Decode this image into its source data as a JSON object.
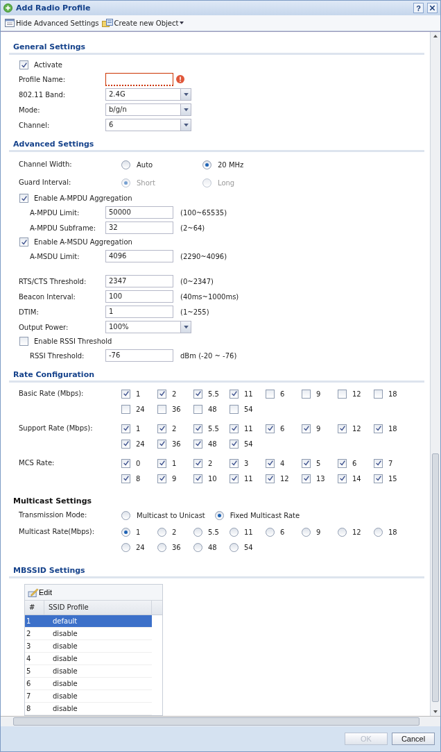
{
  "window": {
    "title": "Add Radio Profile",
    "help": "?"
  },
  "toolbar": [
    {
      "label": "Hide Advanced Settings",
      "kind": "settings",
      "dropdown": false
    },
    {
      "label": "Create new Object",
      "kind": "object",
      "dropdown": true
    }
  ],
  "sections": [
    {
      "kind": "banner",
      "title": "General Settings",
      "rows": [
        {
          "kind": "checkbox",
          "label": "Activate",
          "checked": true
        },
        {
          "kind": "text",
          "label": "Profile Name:",
          "invalid": true
        },
        {
          "kind": "select",
          "label": "802.11 Band:",
          "value": "2.4G"
        },
        {
          "kind": "select",
          "label": "Mode:",
          "value": "b/g/n"
        },
        {
          "kind": "select",
          "label": "Channel:",
          "value": "6"
        }
      ]
    },
    {
      "kind": "banner",
      "title": "Advanced Settings",
      "rows": [
        {
          "kind": "radio",
          "label": "Channel Width:",
          "disabled": false,
          "options": [
            {
              "label": "Auto",
              "selected": false
            },
            {
              "label": "20 MHz",
              "selected": true
            }
          ]
        },
        {
          "kind": "radio",
          "label": "Guard Interval:",
          "disabled": true,
          "options": [
            {
              "label": "Short",
              "selected": true
            },
            {
              "label": "Long",
              "selected": false
            }
          ]
        },
        {
          "kind": "checkbox",
          "label": "Enable A-MPDU Aggregation",
          "checked": true,
          "children": [
            {
              "kind": "text",
              "label": "A-MPDU Limit:",
              "value": "50000",
              "hint": "(100~65535)"
            },
            {
              "kind": "text",
              "label": "A-MPDU Subframe:",
              "value": "32",
              "hint": "(2~64)"
            }
          ]
        },
        {
          "kind": "checkbox",
          "label": "Enable A-MSDU Aggregation",
          "checked": true,
          "children": [
            {
              "kind": "text",
              "label": "A-MSDU Limit:",
              "value": "4096",
              "hint": "(2290~4096)"
            }
          ]
        },
        {
          "kind": "text",
          "label": "RTS/CTS Threshold:",
          "value": "2347",
          "hint": "(0~2347)"
        },
        {
          "kind": "text",
          "label": "Beacon Interval:",
          "value": "100",
          "hint": "(40ms~1000ms)"
        },
        {
          "kind": "text",
          "label": "DTIM:",
          "value": "1",
          "hint": "(1~255)"
        },
        {
          "kind": "select",
          "label": "Output Power:",
          "value": "100%"
        },
        {
          "kind": "checkbox",
          "label": "Enable RSSI Threshold",
          "checked": false,
          "children": [
            {
              "kind": "text",
              "label": "RSSI Threshold:",
              "value": "-76",
              "hint": "dBm (-20 ~ -76)"
            }
          ]
        }
      ]
    },
    {
      "kind": "banner",
      "title": "Rate Configuration",
      "rows": [
        {
          "kind": "checkgrid",
          "label": "Basic Rate (Mbps):",
          "items": [
            {
              "label": "1",
              "checked": true
            },
            {
              "label": "2",
              "checked": true
            },
            {
              "label": "5.5",
              "checked": true
            },
            {
              "label": "11",
              "checked": true
            },
            {
              "label": "6",
              "checked": false
            },
            {
              "label": "9",
              "checked": false
            },
            {
              "label": "12",
              "checked": false
            },
            {
              "label": "18",
              "checked": false
            },
            {
              "label": "24",
              "checked": false
            },
            {
              "label": "36",
              "checked": false
            },
            {
              "label": "48",
              "checked": false
            },
            {
              "label": "54",
              "checked": false
            }
          ]
        },
        {
          "kind": "checkgrid",
          "label": "Support Rate (Mbps):",
          "items": [
            {
              "label": "1",
              "checked": true
            },
            {
              "label": "2",
              "checked": true
            },
            {
              "label": "5.5",
              "checked": true
            },
            {
              "label": "11",
              "checked": true
            },
            {
              "label": "6",
              "checked": true
            },
            {
              "label": "9",
              "checked": true
            },
            {
              "label": "12",
              "checked": true
            },
            {
              "label": "18",
              "checked": true
            },
            {
              "label": "24",
              "checked": true
            },
            {
              "label": "36",
              "checked": true
            },
            {
              "label": "48",
              "checked": true
            },
            {
              "label": "54",
              "checked": true
            }
          ]
        },
        {
          "kind": "checkgrid",
          "label": "MCS Rate:",
          "items": [
            {
              "label": "0",
              "checked": true
            },
            {
              "label": "1",
              "checked": true
            },
            {
              "label": "2",
              "checked": true
            },
            {
              "label": "3",
              "checked": true
            },
            {
              "label": "4",
              "checked": true
            },
            {
              "label": "5",
              "checked": true
            },
            {
              "label": "6",
              "checked": true
            },
            {
              "label": "7",
              "checked": true
            },
            {
              "label": "8",
              "checked": true
            },
            {
              "label": "9",
              "checked": true
            },
            {
              "label": "10",
              "checked": true
            },
            {
              "label": "11",
              "checked": true
            },
            {
              "label": "12",
              "checked": true
            },
            {
              "label": "13",
              "checked": true
            },
            {
              "label": "14",
              "checked": true
            },
            {
              "label": "15",
              "checked": true
            }
          ]
        }
      ]
    },
    {
      "kind": "plain",
      "title": "Multicast Settings",
      "rows": [
        {
          "kind": "radio",
          "label": "Transmission Mode:",
          "disabled": false,
          "options": [
            {
              "label": "Multicast to Unicast",
              "selected": false
            },
            {
              "label": "Fixed Multicast Rate",
              "selected": true
            }
          ]
        },
        {
          "kind": "radiogrid",
          "label": "Multicast Rate(Mbps):",
          "items": [
            {
              "label": "1",
              "selected": true
            },
            {
              "label": "2",
              "selected": false
            },
            {
              "label": "5.5",
              "selected": false
            },
            {
              "label": "11",
              "selected": false
            },
            {
              "label": "6",
              "selected": false
            },
            {
              "label": "9",
              "selected": false
            },
            {
              "label": "12",
              "selected": false
            },
            {
              "label": "18",
              "selected": false
            },
            {
              "label": "24",
              "selected": false
            },
            {
              "label": "36",
              "selected": false
            },
            {
              "label": "48",
              "selected": false
            },
            {
              "label": "54",
              "selected": false
            }
          ]
        }
      ]
    },
    {
      "kind": "banner",
      "title": "MBSSID Settings",
      "table": {
        "edit": "Edit",
        "columns": [
          "#",
          "SSID Profile"
        ],
        "rows": [
          {
            "cells": [
              "1",
              "default"
            ],
            "selected": true
          },
          {
            "cells": [
              "2",
              "disable"
            ],
            "selected": false
          },
          {
            "cells": [
              "3",
              "disable"
            ],
            "selected": false
          },
          {
            "cells": [
              "4",
              "disable"
            ],
            "selected": false
          },
          {
            "cells": [
              "5",
              "disable"
            ],
            "selected": false
          },
          {
            "cells": [
              "6",
              "disable"
            ],
            "selected": false
          },
          {
            "cells": [
              "7",
              "disable"
            ],
            "selected": false
          },
          {
            "cells": [
              "8",
              "disable"
            ],
            "selected": false
          }
        ]
      }
    }
  ],
  "buttons": [
    {
      "label": "OK",
      "disabled": true
    },
    {
      "label": "Cancel",
      "disabled": false
    }
  ]
}
